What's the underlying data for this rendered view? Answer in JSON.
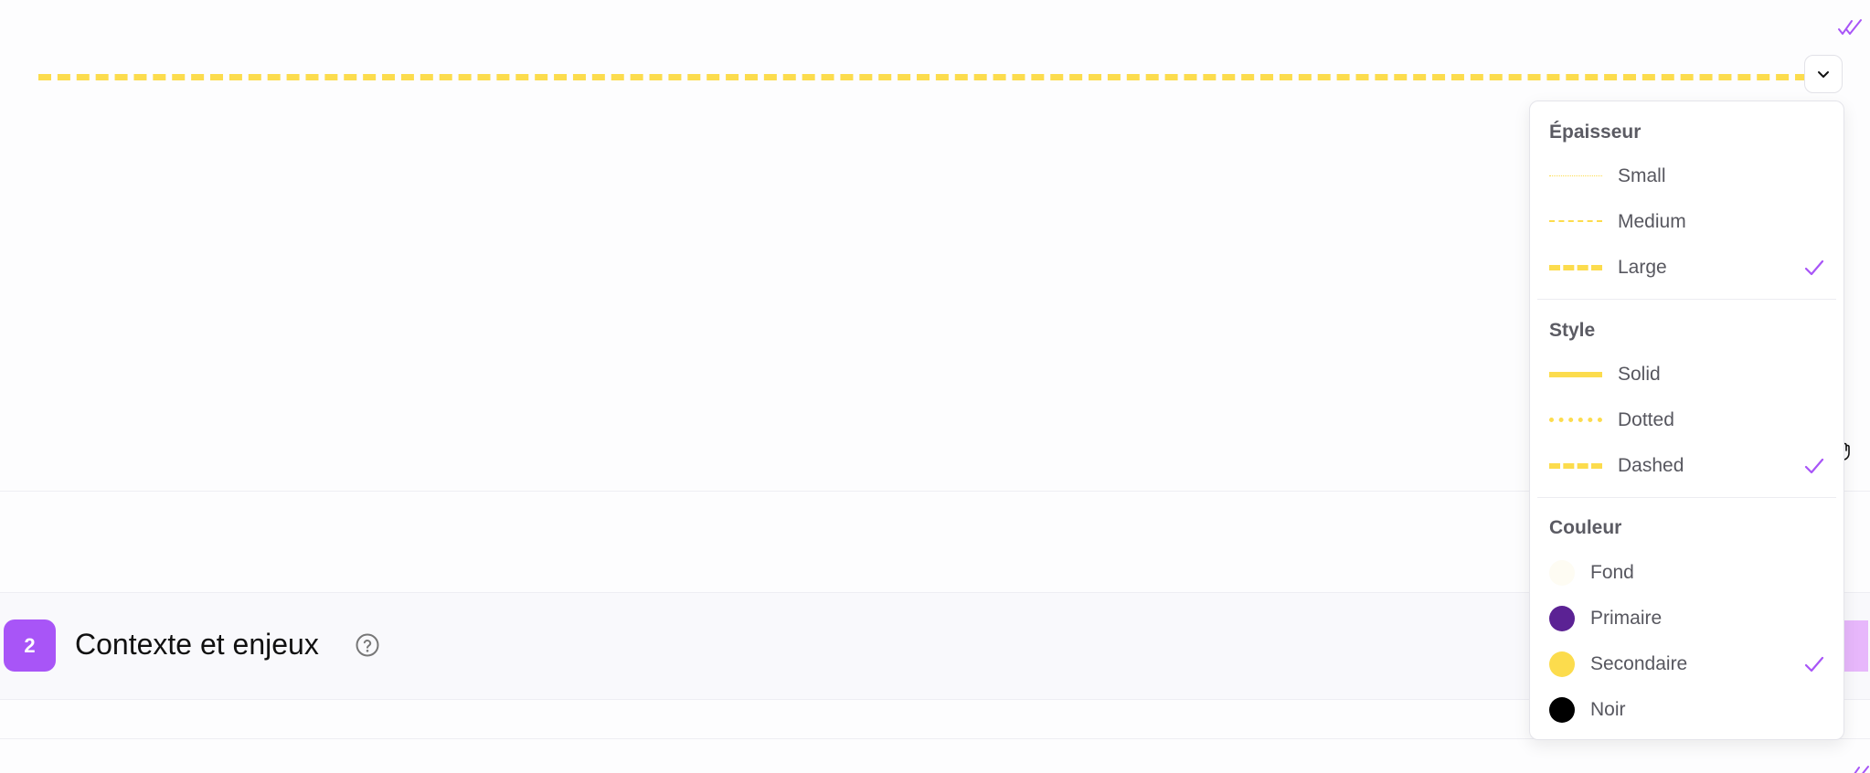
{
  "section": {
    "number": "2",
    "title": "Contexte et enjeux"
  },
  "line": {
    "color": "#fcdc4d",
    "thickness": "Large",
    "style": "Dashed"
  },
  "dropdown": {
    "thickness_title": "Épaisseur",
    "thickness_options": [
      {
        "label": "Small",
        "selected": false
      },
      {
        "label": "Medium",
        "selected": false
      },
      {
        "label": "Large",
        "selected": true
      }
    ],
    "style_title": "Style",
    "style_options": [
      {
        "label": "Solid",
        "selected": false
      },
      {
        "label": "Dotted",
        "selected": false
      },
      {
        "label": "Dashed",
        "selected": true
      }
    ],
    "color_title": "Couleur",
    "color_options": [
      {
        "label": "Fond",
        "color": "#fefcf3",
        "selected": false
      },
      {
        "label": "Primaire",
        "color": "#5b2294",
        "selected": false
      },
      {
        "label": "Secondaire",
        "color": "#fcdc4d",
        "selected": true
      },
      {
        "label": "Noir",
        "color": "#000000",
        "selected": false
      }
    ]
  },
  "colors": {
    "accent": "#a855f7",
    "line": "#fcdc4d"
  },
  "icons": {
    "top_right": "double-check-icon",
    "collapse": "chevron-down-icon",
    "help": "help-circle-icon",
    "selected": "check-icon",
    "cursor": "hand-pointer-icon"
  }
}
